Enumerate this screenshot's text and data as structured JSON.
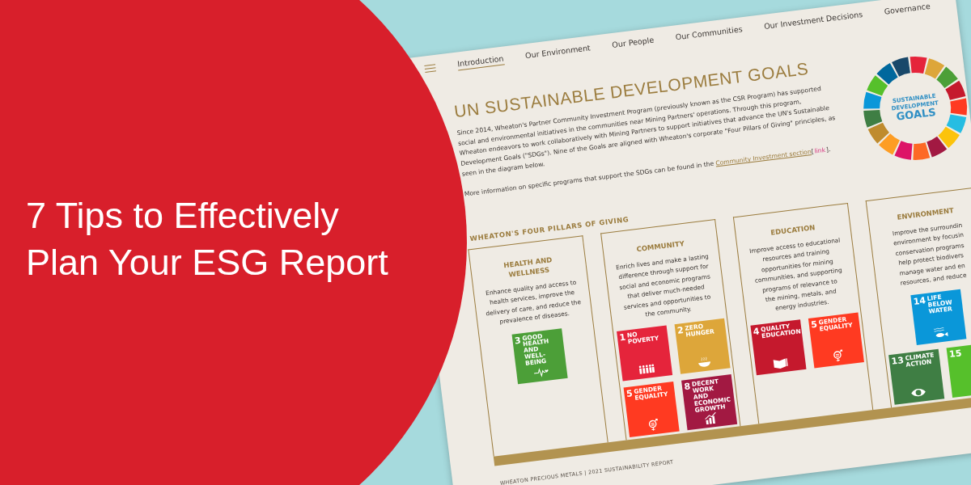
{
  "title": [
    "7 Tips to Effectively",
    "Plan Your ESG Report"
  ],
  "document": {
    "nav": [
      {
        "label": "Introduction",
        "selected": true
      },
      {
        "label": "Our Environment",
        "selected": false
      },
      {
        "label": "Our People",
        "selected": false
      },
      {
        "label": "Our Communities",
        "selected": false
      },
      {
        "label": "Our Investment Decisions",
        "selected": false
      },
      {
        "label": "Governance",
        "selected": false
      }
    ],
    "heading": "UN SUSTAINABLE DEVELOPMENT GOALS",
    "paragraph": [
      "Since 2014, Wheaton's Partner Community Investment Program (previously known as the CSR Program) has supported",
      "social and environmental initiatives in the communities near Mining Partners' operations. Through this program,",
      "Wheaton endeavors to work collaboratively with Mining Partners to support initiatives that advance the UN's Sustainable",
      "Development Goals (\"SDGs\"). Nine of the Goals are aligned with Wheaton's corporate \"Four Pillars of Giving\" principles, as",
      "seen in the diagram below."
    ],
    "more_info": {
      "text": "More information on specific programs that support the SDGs can be found in the",
      "link": "Community Investment section",
      "ref_open": "[",
      "ref": "link",
      "ref_close": "]."
    },
    "wheel": [
      "SUSTAINABLE",
      "DEVELOPMENT",
      "GOALS"
    ],
    "pillars_heading": "WHEATON'S FOUR PILLARS OF GIVING",
    "pillars": [
      {
        "title": [
          "HEALTH AND",
          "WELLNESS"
        ],
        "text": [
          "Enhance quality and access to",
          "health services, improve the",
          "delivery of care, and reduce the",
          "prevalence of diseases."
        ],
        "tile_rows": [
          [
            {
              "number": "3",
              "label": "GOOD HEALTH AND WELL-BEING",
              "kind": "heartbeat",
              "color": "#4c9f38"
            }
          ]
        ]
      },
      {
        "title": [
          "COMMUNITY"
        ],
        "text": [
          "Enrich lives and make a lasting",
          "difference through support for",
          "social and economic programs",
          "that deliver much-needed",
          "services and opportunities to",
          "the community."
        ],
        "tile_rows": [
          [
            {
              "number": "1",
              "label": "NO POVERTY",
              "kind": "people",
              "color": "#e5243b"
            },
            {
              "number": "2",
              "label": "ZERO HUNGER",
              "kind": "bowl",
              "color": "#dda63a"
            }
          ],
          [
            {
              "number": "5",
              "label": "GENDER EQUALITY",
              "kind": "gender",
              "color": "#ff3a21"
            },
            {
              "number": "8",
              "label": "DECENT WORK AND ECONOMIC GROWTH",
              "kind": "chart",
              "color": "#a21942"
            }
          ]
        ]
      },
      {
        "title": [
          "EDUCATION"
        ],
        "text": [
          "Improve access to educational",
          "resources and training",
          "opportunities for mining",
          "communities, and supporting",
          "programs of relevance to",
          "the mining, metals, and",
          "energy industries."
        ],
        "tile_rows": [
          [
            {
              "number": "4",
              "label": "QUALITY EDUCATION",
              "kind": "book",
              "color": "#c5192d"
            },
            {
              "number": "5",
              "label": "GENDER EQUALITY",
              "kind": "gender",
              "color": "#ff3a21"
            }
          ]
        ]
      },
      {
        "title": [
          "ENVIRONMENT"
        ],
        "text": [
          "Improve the surroundin",
          "environment by focusin",
          "conservation programs",
          "help protect biodivers",
          "manage water and en",
          "resources, and reduce"
        ],
        "tile_rows": [
          [
            {
              "number": "14",
              "label": "LIFE BELOW WATER",
              "kind": "fish",
              "color": "#0a97d9"
            }
          ],
          [
            {
              "number": "13",
              "label": "CLIMATE ACTION",
              "kind": "eye",
              "color": "#3f7e44"
            },
            {
              "number": "15",
              "kind": "none",
              "color": "#56c02b"
            }
          ]
        ]
      }
    ],
    "footer": "WHEATON PRECIOUS METALS | 2021 SUSTAINABILITY REPORT"
  }
}
